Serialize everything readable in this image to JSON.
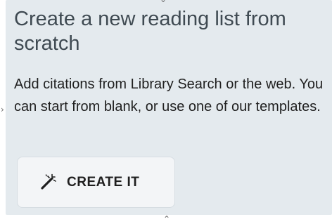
{
  "card": {
    "title": "Create a new reading list from scratch",
    "description": "Add citations from Library Search or the web. You can start from blank, or use one of our templates.",
    "button_label": "CREATE IT",
    "button_icon": "magic-wand-icon"
  },
  "colors": {
    "card_background": "#e4eaee",
    "title_text": "#3f4a52",
    "body_text": "#1f1f1f",
    "button_background": "#f3f5f7"
  }
}
